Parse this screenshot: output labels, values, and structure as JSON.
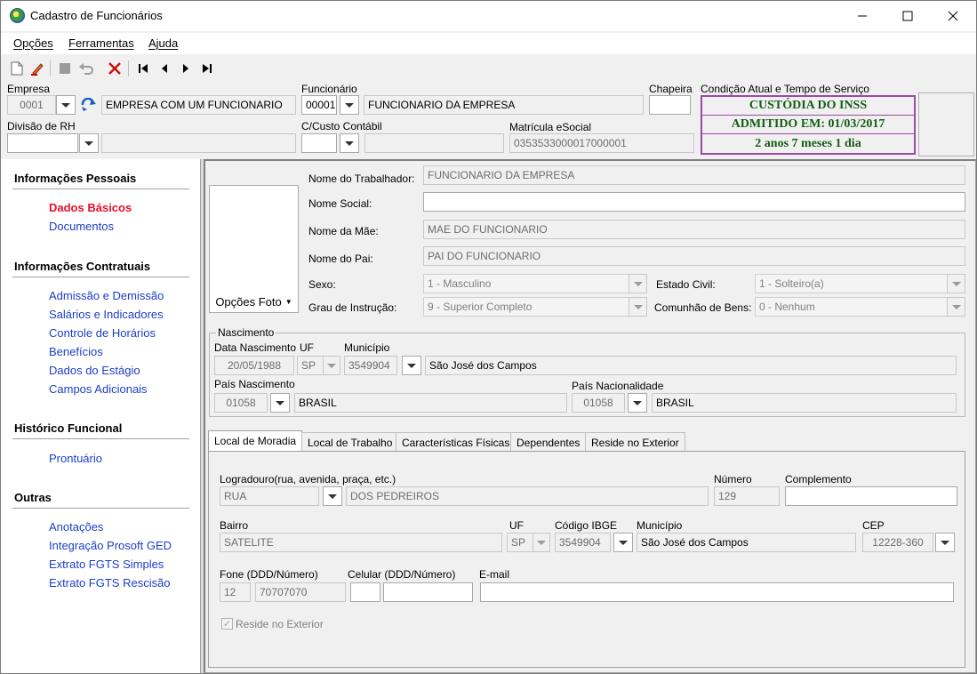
{
  "window": {
    "title": "Cadastro de Funcionários"
  },
  "menu": {
    "opcoes": "Opções",
    "ferramentas": "Ferramentas",
    "ajuda": "Ajuda"
  },
  "header": {
    "empresa_label": "Empresa",
    "empresa_code": "0001",
    "empresa_name": "EMPRESA COM UM FUNCIONARIO",
    "funcionario_label": "Funcionário",
    "funcionario_code": "00001",
    "funcionario_name": "FUNCIONARIO DA EMPRESA",
    "chapeira_label": "Chapeira",
    "chapeira_value": "",
    "condicao_label": "Condição Atual e Tempo de Serviço",
    "divisao_label": "Divisão de RH",
    "divisao_value": "",
    "divisao_name": "",
    "custo_label": "C/Custo Contábil",
    "custo_value": "",
    "custo_name": "",
    "matricula_label": "Matrícula eSocial",
    "matricula_value": "0353533000017000001"
  },
  "status": {
    "line1": "CUSTÓDIA DO INSS",
    "line2": "ADMITIDO EM: 01/03/2017",
    "line3": "2 anos 7 meses 1 dia",
    "color": "#165c16",
    "border_color": "#9b4aa7"
  },
  "sidebar": {
    "sections": [
      {
        "title": "Informações Pessoais",
        "items": [
          "Dados Básicos",
          "Documentos"
        ]
      },
      {
        "title": "Informações Contratuais",
        "items": [
          "Admissão e Demissão",
          "Salários e Indicadores",
          "Controle de Horários",
          "Benefícios",
          "Dados do Estágio",
          "Campos Adicionais"
        ]
      },
      {
        "title": "Histórico Funcional",
        "items": [
          "Prontuário"
        ]
      },
      {
        "title": "Outras",
        "items": [
          "Anotações",
          "Integração Prosoft GED",
          "Extrato FGTS Simples",
          "Extrato FGTS Rescisão"
        ]
      }
    ],
    "active_item": "Dados Básicos"
  },
  "basic": {
    "photo_button": "Opções Foto",
    "nome_trabalhador_label": "Nome do Trabalhador:",
    "nome_trabalhador": "FUNCIONARIO DA EMPRESA",
    "nome_social_label": "Nome Social:",
    "nome_social": "",
    "nome_mae_label": "Nome da Mãe:",
    "nome_mae": "MAE DO FUNCIONARIO",
    "nome_pai_label": "Nome do Pai:",
    "nome_pai": "PAI DO FUNCIONARIO",
    "sexo_label": "Sexo:",
    "sexo": "1 - Masculino",
    "estado_civil_label": "Estado Civil:",
    "estado_civil": "1 - Solteiro(a)",
    "grau_label": "Grau de Instrução:",
    "grau": "9 - Superior Completo",
    "comunhao_label": "Comunhão de Bens:",
    "comunhao": "0 - Nenhum"
  },
  "nascimento": {
    "group_title": "Nascimento",
    "data_label": "Data Nascimento",
    "data": "20/05/1988",
    "uf_label": "UF",
    "uf": "SP",
    "municipio_label": "Município",
    "municipio_code": "3549904",
    "municipio_name": "São José dos Campos",
    "pais_label": "País Nascimento",
    "pais_code": "01058",
    "pais_name": "BRASIL",
    "nacionalidade_label": "País Nacionalidade",
    "nacionalidade_code": "01058",
    "nacionalidade_name": "BRASIL"
  },
  "tabs": [
    "Local de Moradia",
    "Local de Trabalho",
    "Características Físicas",
    "Dependentes",
    "Reside no Exterior"
  ],
  "moradia": {
    "logradouro_label": "Logradouro(rua, avenida, praça, etc.)",
    "logradouro_tipo": "RUA",
    "logradouro_nome": "DOS PEDREIROS",
    "numero_label": "Número",
    "numero": "129",
    "complemento_label": "Complemento",
    "complemento": "",
    "bairro_label": "Bairro",
    "bairro": "SATELITE",
    "uf_label": "UF",
    "uf": "SP",
    "ibge_label": "Código IBGE",
    "ibge": "3549904",
    "municipio_label": "Município",
    "municipio": "São José dos Campos",
    "cep_label": "CEP",
    "cep": "12228-360",
    "fone_label": "Fone (DDD/Número)",
    "fone_ddd": "12",
    "fone_num": "70707070",
    "celular_label": "Celular (DDD/Número)",
    "celular_ddd": "",
    "celular_num": "",
    "email_label": "E-mail",
    "email": "",
    "reside_exterior_label": "Reside no Exterior",
    "reside_exterior_checked": true
  }
}
